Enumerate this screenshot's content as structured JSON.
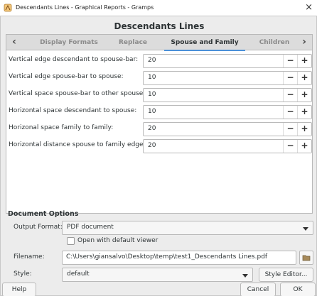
{
  "window": {
    "title": "Descendants Lines - Graphical Reports - Gramps",
    "close_glyph": "×"
  },
  "dialog": {
    "heading": "Descendants Lines"
  },
  "tabs": [
    {
      "label": "Display Formats",
      "active": false
    },
    {
      "label": "Replace",
      "active": false
    },
    {
      "label": "Spouse and Family",
      "active": true
    },
    {
      "label": "Children",
      "active": false
    }
  ],
  "tab_arrows": {
    "left": "‹",
    "right": "›"
  },
  "options": [
    {
      "label": "Vertical edge descendant to spouse-bar:",
      "value": "20"
    },
    {
      "label": "Vertical edge spouse-bar to spouse:",
      "value": "10"
    },
    {
      "label": "Vertical space spouse-bar to other spouse:",
      "value": "10"
    },
    {
      "label": "Horizontal space descendant to spouse:",
      "value": "10"
    },
    {
      "label": "Horizonal space family to family:",
      "value": "20"
    },
    {
      "label": "Horizontal distance spouse to family edge:",
      "value": "20"
    }
  ],
  "spin": {
    "minus": "−",
    "plus": "+"
  },
  "document_options": {
    "title": "Document Options",
    "output_format_label": "Output Format:",
    "output_format_value": "PDF document",
    "open_viewer_label": "Open with default viewer",
    "filename_label": "Filename:",
    "filename_value": "C:\\Users\\giansalvo\\Desktop\\temp\\test1_Descendants Lines.pdf",
    "style_label": "Style:",
    "style_value": "default",
    "style_editor_label": "Style Editor..."
  },
  "buttons": {
    "help": "Help",
    "cancel": "Cancel",
    "ok": "OK"
  },
  "icons": {
    "app": "gramps-icon",
    "folder": "folder-icon",
    "dropdown": "dropdown-arrow-icon"
  },
  "colors": {
    "accent": "#4a90d9"
  }
}
